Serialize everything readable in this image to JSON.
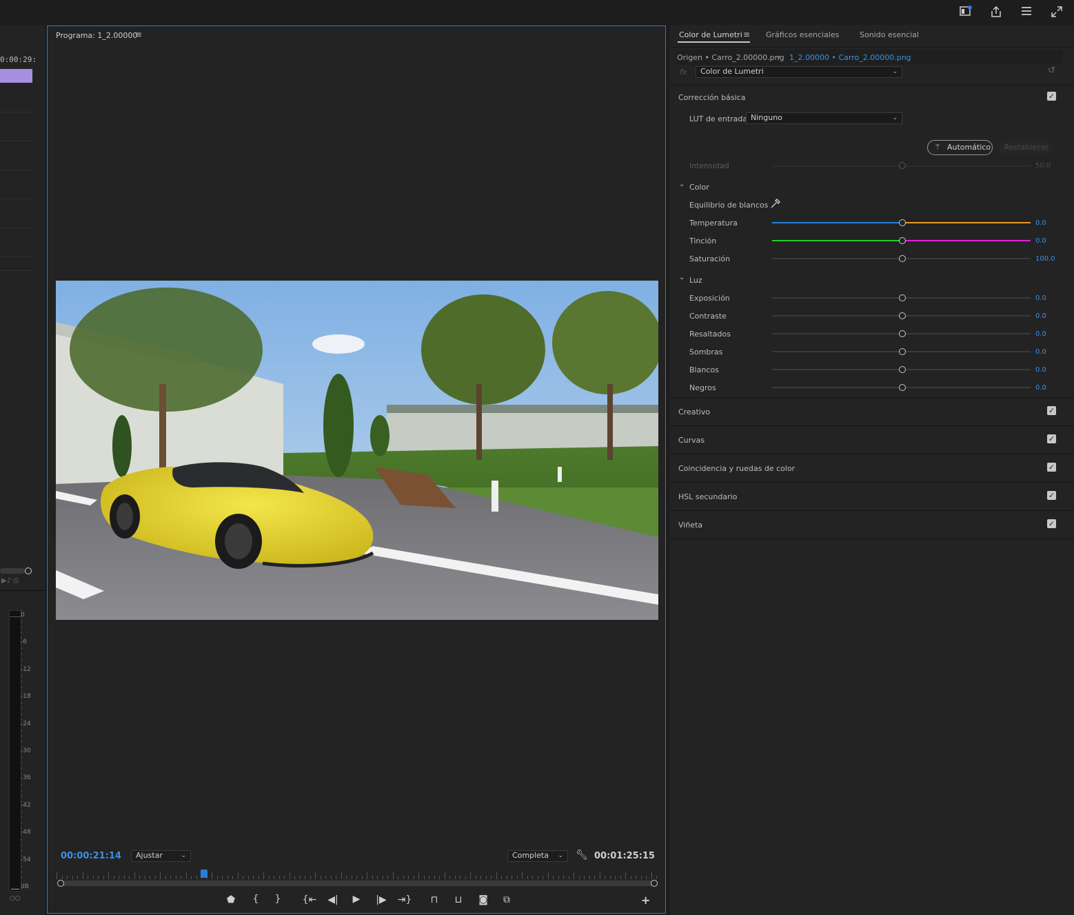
{
  "topbar": {
    "icons": [
      "workspace-icon",
      "share-icon",
      "panel-menu-icon",
      "fullscreen-icon"
    ]
  },
  "left_strip": {
    "timecode": "0:00:29:",
    "meter_ticks": [
      "0",
      "-6",
      "-12",
      "-18",
      "-24",
      "-30",
      "-36",
      "-42",
      "-48",
      "-54",
      "dB"
    ],
    "meter_bottom": "○○"
  },
  "program": {
    "title": "Programa: 1_2.00000",
    "current_time": "00:00:21:14",
    "zoom": "Ajustar",
    "resolution": "Completa",
    "duration": "00:01:25:15",
    "playhead_fraction": 0.24,
    "controls": [
      "marker-icon",
      "mark-in-icon",
      "mark-out-icon",
      "go-to-in-icon",
      "step-back-icon",
      "play-icon",
      "step-forward-icon",
      "go-to-out-icon",
      "lift-icon",
      "extract-icon",
      "export-frame-icon",
      "compare-icon"
    ],
    "add": "+"
  },
  "lumetri": {
    "tabs": [
      "Color de Lumetri",
      "Gráficos esenciales",
      "Sonido esencial"
    ],
    "source": "Origen • Carro_2.00000.png",
    "sequence_clip": "1_2.00000 • Carro_2.00000.png",
    "fx": "fx",
    "effect": "Color de Lumetri",
    "basic": {
      "title": "Corrección básica",
      "lut_label": "LUT de entrada",
      "lut_value": "Ninguno",
      "auto": "Automático",
      "reset": "Restablecer",
      "intensity_label": "Intensidad",
      "intensity_value": "50.0",
      "color_title": "Color",
      "wb_label": "Equilibrio de blancos",
      "temp_label": "Temperatura",
      "temp_value": "0.0",
      "tint_label": "Tinción",
      "tint_value": "0.0",
      "sat_label": "Saturación",
      "sat_value": "100.0",
      "light_title": "Luz",
      "light": [
        {
          "label": "Exposición",
          "value": "0.0"
        },
        {
          "label": "Contraste",
          "value": "0.0"
        },
        {
          "label": "Resaltados",
          "value": "0.0"
        },
        {
          "label": "Sombras",
          "value": "0.0"
        },
        {
          "label": "Blancos",
          "value": "0.0"
        },
        {
          "label": "Negros",
          "value": "0.0"
        }
      ]
    },
    "sections": [
      "Creativo",
      "Curvas",
      "Coincidencia y ruedas de color",
      "HSL secundario",
      "Viñeta"
    ]
  },
  "colors": {
    "accent": "#2d7bd9",
    "value_blue": "#3d8fe8",
    "panel": "#232323"
  }
}
